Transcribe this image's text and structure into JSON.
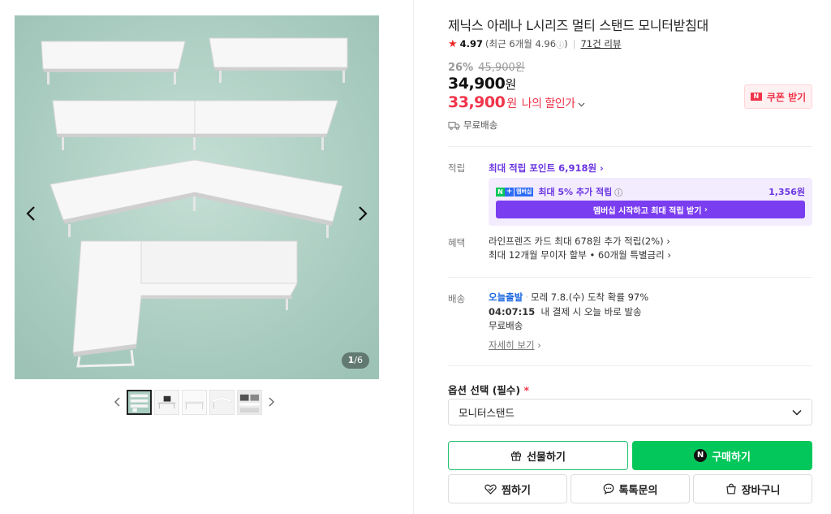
{
  "gallery": {
    "counter_current": "1",
    "counter_total": "/6",
    "thumb_count": 5
  },
  "product": {
    "title": "제닉스 아레나 L시리즈 멀티 스탠드 모니터받침대",
    "rating": "4.97",
    "rating_recent": "(최근 6개월 4.96",
    "rating_recent_close": ")",
    "review_link": "71건 리뷰",
    "discount_rate": "26%",
    "original_price": "45,900원",
    "price": "34,900",
    "price_unit": "원",
    "my_price": "33,900",
    "my_price_unit": "원",
    "my_price_label": "나의 할인가",
    "coupon_label": "쿠폰 받기",
    "shipping_fee": "무료배송"
  },
  "points": {
    "label": "적립",
    "max_points_link": "최대 적립 포인트 6,918원",
    "membership_text": "최대 5% 추가 적립",
    "membership_logo_text": "멤버십",
    "membership_amount": "1,356원",
    "membership_button": "멤버십 시작하고 최대 적립 받기"
  },
  "benefits": {
    "label": "혜택",
    "card_benefit": "라인프렌즈 카드 최대 678원 추가 적립(2%)",
    "installment": "최대 12개월 무이자 할부 • 60개월 특별금리"
  },
  "delivery": {
    "label": "배송",
    "today_badge": "오늘출발",
    "arrival": "모레 7.8.(수) 도착 확률 97%",
    "countdown": "04:07:15",
    "countdown_text": "내 결제 시 오늘 바로 발송",
    "fee": "무료배송",
    "detail_link": "자세히 보기"
  },
  "option": {
    "label": "옵션 선택 (필수)",
    "required_mark": "*",
    "selected": "모니터스탠드"
  },
  "actions": {
    "gift": "선물하기",
    "buy": "구매하기",
    "buy_badge": "N",
    "zzim": "찜하기",
    "talk": "톡톡문의",
    "cart": "장바구니"
  },
  "colors": {
    "naver_green": "#03c75a",
    "discount_red": "#f0354a",
    "membership_purple": "#7b3df0",
    "photo_bg": "#a9ccc0"
  }
}
